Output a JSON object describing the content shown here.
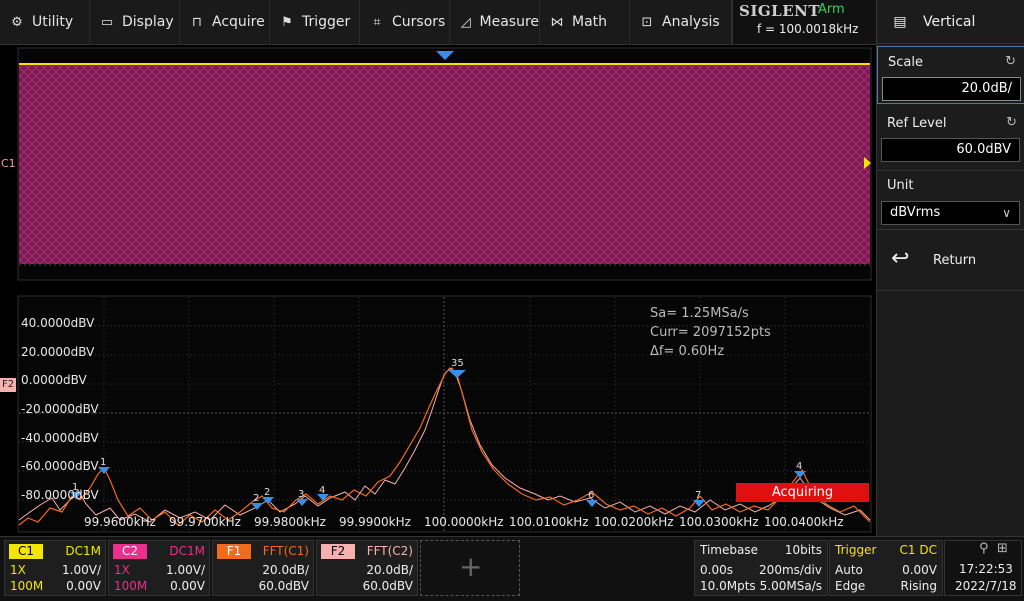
{
  "menu": {
    "items": [
      {
        "label": "Utility",
        "icon": "gear-icon",
        "glyph": "⚙"
      },
      {
        "label": "Display",
        "icon": "monitor-icon",
        "glyph": "▭"
      },
      {
        "label": "Acquire",
        "icon": "acquire-icon",
        "glyph": "⊓"
      },
      {
        "label": "Trigger",
        "icon": "flag-icon",
        "glyph": "⚑"
      },
      {
        "label": "Cursors",
        "icon": "cursor-cross-icon",
        "glyph": "⌗"
      },
      {
        "label": "Measure",
        "icon": "measure-icon",
        "glyph": "◿"
      },
      {
        "label": "Math",
        "icon": "math-icon",
        "glyph": "⋈"
      },
      {
        "label": "Analysis",
        "icon": "analysis-icon",
        "glyph": "⊡"
      }
    ]
  },
  "brand": {
    "name": "SIGLENT",
    "state": "Arm",
    "frequency": "f = 100.0018kHz"
  },
  "panel": {
    "title": "Vertical",
    "scale_label": "Scale",
    "scale_value": "20.0dB/",
    "ref_label": "Ref Level",
    "ref_value": "60.0dBV",
    "unit_label": "Unit",
    "unit_value": "dBVrms",
    "return_label": "Return"
  },
  "labels": {
    "c1": "C1",
    "f2": "F2"
  },
  "fft": {
    "y_labels": [
      "40.0000dBV",
      "20.0000dBV",
      "0.0000dBV",
      "-20.0000dBV",
      "-40.0000dBV",
      "-60.0000dBV",
      "-80.0000dBV"
    ],
    "x_labels": [
      "99.9600kHz",
      "99.9700kHz",
      "99.9800kHz",
      "99.9900kHz",
      "100.0000kHz",
      "100.0100kHz",
      "100.0200kHz",
      "100.0300kHz",
      "100.0400kHz"
    ],
    "info": {
      "sa": "Sa=  1.25MSa/s",
      "curr": "Curr= 2097152pts",
      "df": "Δf=  0.60Hz"
    },
    "markers": [
      "1",
      "1",
      "2",
      "2",
      "3",
      "4",
      "35",
      "6",
      "7",
      "4"
    ],
    "acquiring": "Acquiring"
  },
  "channels": {
    "c1": {
      "tag": "C1",
      "coupling": "DC1M",
      "probe": "1X",
      "scale": "1.00V/",
      "bw": "100M",
      "offset": "0.00V",
      "color": "#f2e600"
    },
    "c2": {
      "tag": "C2",
      "coupling": "DC1M",
      "probe": "1X",
      "scale": "1.00V/",
      "bw": "100M",
      "offset": "0.00V",
      "color": "#e8308c"
    },
    "f1": {
      "tag": "F1",
      "src": "FFT(C1)",
      "scale": "20.0dB/",
      "ref": "60.0dBV",
      "color": "#f26a1c"
    },
    "f2": {
      "tag": "F2",
      "src": "FFT(C2)",
      "scale": "20.0dB/",
      "ref": "60.0dBV",
      "color": "#f8b0b0"
    }
  },
  "timebase": {
    "label": "Timebase",
    "bits": "10bits",
    "delay": "0.00s",
    "scale": "200ms/div",
    "mem": "10.0Mpts",
    "rate": "5.00MSa/s"
  },
  "trigger": {
    "label": "Trigger",
    "source": "C1 DC",
    "mode": "Auto",
    "level": "0.00V",
    "type": "Edge",
    "slope": "Rising"
  },
  "clock": {
    "time": "17:22:53",
    "date": "2022/7/18"
  }
}
